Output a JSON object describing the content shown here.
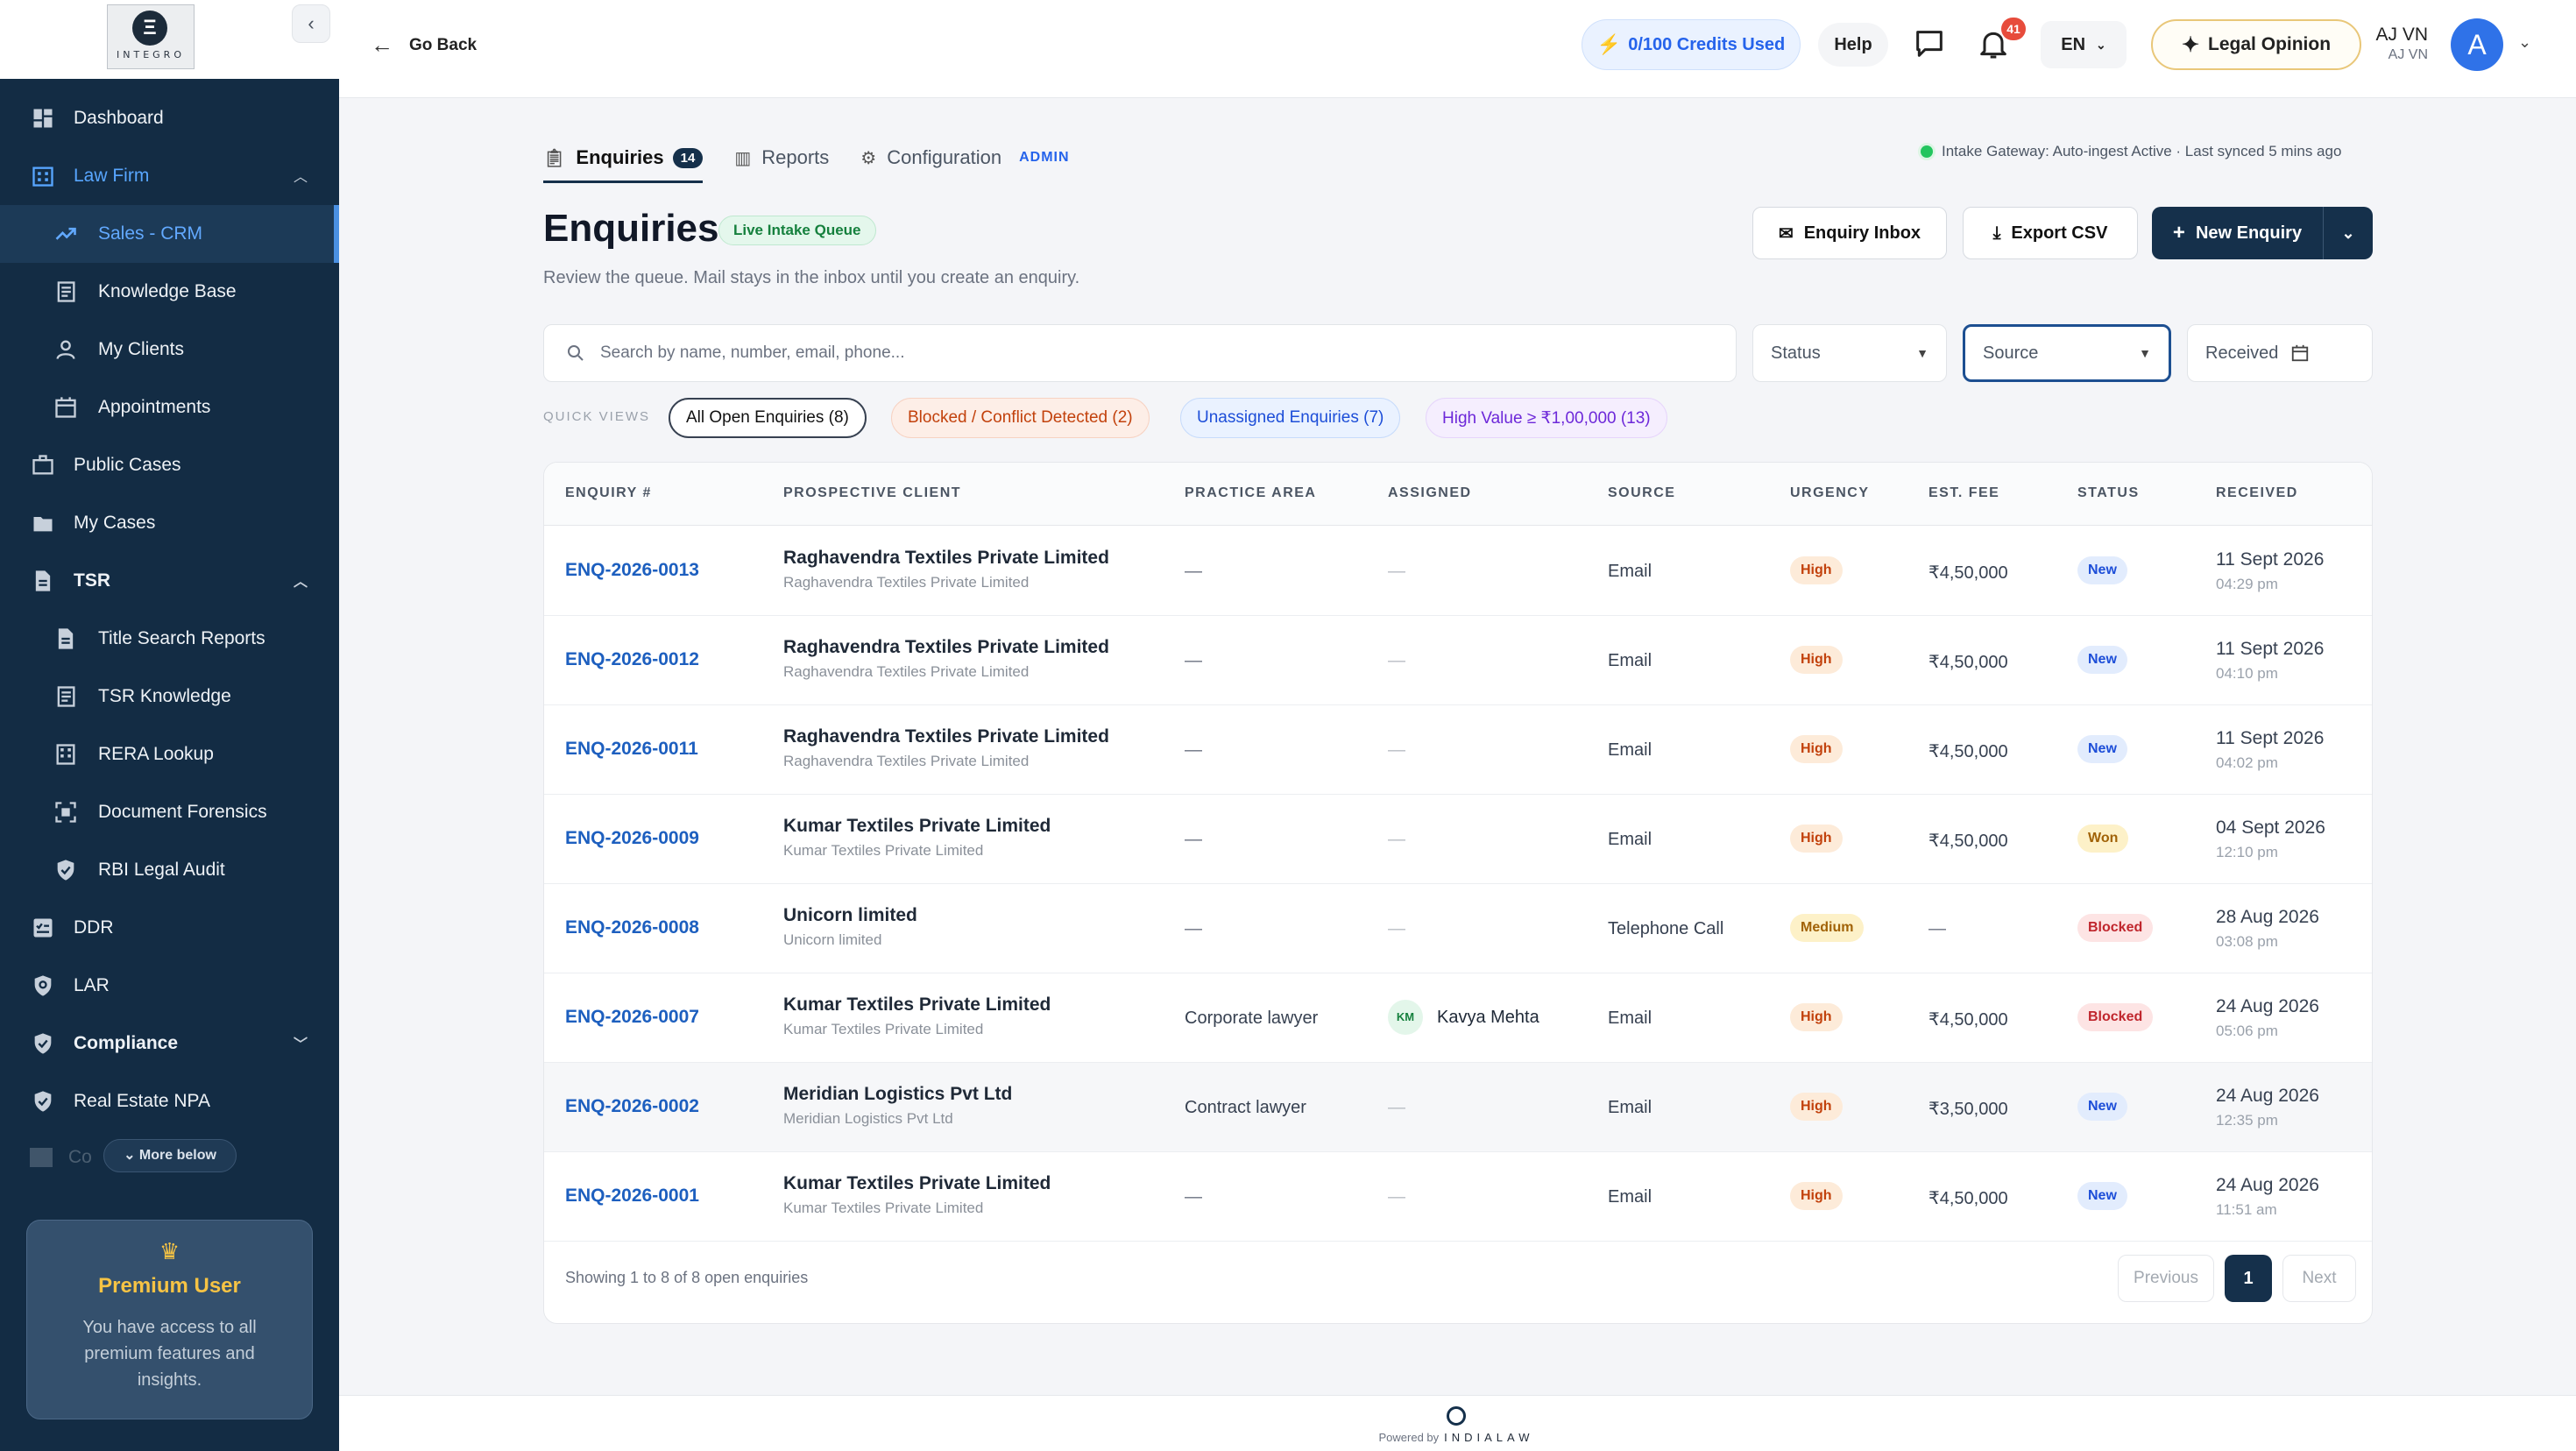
{
  "brand": {
    "logo_letter": "Ξ",
    "logo_text": "INTEGRO"
  },
  "sidebar": {
    "items": [
      {
        "label": "Dashboard"
      },
      {
        "label": "Law Firm"
      },
      {
        "label": "Sales - CRM"
      },
      {
        "label": "Knowledge Base"
      },
      {
        "label": "My Clients"
      },
      {
        "label": "Appointments"
      },
      {
        "label": "Public Cases"
      },
      {
        "label": "My Cases"
      },
      {
        "label": "TSR"
      },
      {
        "label": "Title Search Reports"
      },
      {
        "label": "TSR Knowledge"
      },
      {
        "label": "RERA Lookup"
      },
      {
        "label": "Document Forensics"
      },
      {
        "label": "RBI Legal Audit"
      },
      {
        "label": "DDR"
      },
      {
        "label": "LAR"
      },
      {
        "label": "Compliance"
      },
      {
        "label": "Real Estate NPA"
      }
    ],
    "faded_item": "Co",
    "more_below": "More below",
    "premium": {
      "title": "Premium User",
      "desc": "You have access to all premium features and insights."
    }
  },
  "topbar": {
    "go_back": "Go Back",
    "credits": "0/100 Credits Used",
    "help": "Help",
    "notif_count": "41",
    "lang": "EN",
    "legal_opinion": "Legal Opinion",
    "user_name": "AJ VN",
    "user_sub": "AJ VN",
    "avatar_letter": "A"
  },
  "tabs": {
    "enquiries": "Enquiries",
    "enquiries_count": "14",
    "reports": "Reports",
    "configuration": "Configuration",
    "admin": "ADMIN"
  },
  "sync_status": "Intake Gateway: Auto-ingest Active · Last synced 5 mins ago",
  "page": {
    "title": "Enquiries",
    "live_badge": "Live Intake Queue",
    "subtitle": "Review the queue. Mail stays in the inbox until you create an enquiry."
  },
  "actions": {
    "inbox": "Enquiry Inbox",
    "export": "Export CSV",
    "new": "New Enquiry"
  },
  "filters": {
    "search_placeholder": "Search by name, number, email, phone...",
    "status": "Status",
    "source": "Source",
    "received": "Received"
  },
  "quick_views": {
    "label": "QUICK VIEWS",
    "chips": [
      "All Open Enquiries  (8)",
      "Blocked / Conflict Detected  (2)",
      "Unassigned Enquiries  (7)",
      "High Value ≥ ₹1,00,000  (13)"
    ]
  },
  "table": {
    "headers": [
      "ENQUIRY #",
      "PROSPECTIVE CLIENT",
      "PRACTICE AREA",
      "ASSIGNED",
      "SOURCE",
      "URGENCY",
      "EST. FEE",
      "STATUS",
      "RECEIVED"
    ],
    "rows": [
      {
        "id": "ENQ-2026-0013",
        "client": "Raghavendra Textiles Private Limited",
        "client_sub": "Raghavendra Textiles Private Limited",
        "practice": "—",
        "assigned": "—",
        "source": "Email",
        "urgency": "High",
        "fee": "₹4,50,000",
        "status": "New",
        "date": "11 Sept 2026",
        "time": "04:29 pm"
      },
      {
        "id": "ENQ-2026-0012",
        "client": "Raghavendra Textiles Private Limited",
        "client_sub": "Raghavendra Textiles Private Limited",
        "practice": "—",
        "assigned": "—",
        "source": "Email",
        "urgency": "High",
        "fee": "₹4,50,000",
        "status": "New",
        "date": "11 Sept 2026",
        "time": "04:10 pm"
      },
      {
        "id": "ENQ-2026-0011",
        "client": "Raghavendra Textiles Private Limited",
        "client_sub": "Raghavendra Textiles Private Limited",
        "practice": "—",
        "assigned": "—",
        "source": "Email",
        "urgency": "High",
        "fee": "₹4,50,000",
        "status": "New",
        "date": "11 Sept 2026",
        "time": "04:02 pm"
      },
      {
        "id": "ENQ-2026-0009",
        "client": "Kumar Textiles Private Limited",
        "client_sub": "Kumar Textiles Private Limited",
        "practice": "—",
        "assigned": "—",
        "source": "Email",
        "urgency": "High",
        "fee": "₹4,50,000",
        "status": "Won",
        "date": "04 Sept 2026",
        "time": "12:10 pm"
      },
      {
        "id": "ENQ-2026-0008",
        "client": "Unicorn limited",
        "client_sub": "Unicorn limited",
        "practice": "—",
        "assigned": "—",
        "source": "Telephone Call",
        "urgency": "Medium",
        "fee": "—",
        "status": "Blocked",
        "date": "28 Aug 2026",
        "time": "03:08 pm"
      },
      {
        "id": "ENQ-2026-0007",
        "client": "Kumar Textiles Private Limited",
        "client_sub": "Kumar Textiles Private Limited",
        "practice": "Corporate lawyer",
        "assigned_initials": "KM",
        "assigned": "Kavya Mehta",
        "source": "Email",
        "urgency": "High",
        "fee": "₹4,50,000",
        "status": "Blocked",
        "date": "24 Aug 2026",
        "time": "05:06 pm"
      },
      {
        "id": "ENQ-2026-0002",
        "client": "Meridian Logistics Pvt Ltd",
        "client_sub": "Meridian Logistics Pvt Ltd",
        "practice": "Contract lawyer",
        "assigned": "—",
        "source": "Email",
        "urgency": "High",
        "fee": "₹3,50,000",
        "status": "New",
        "date": "24 Aug 2026",
        "time": "12:35 pm"
      },
      {
        "id": "ENQ-2026-0001",
        "client": "Kumar Textiles Private Limited",
        "client_sub": "Kumar Textiles Private Limited",
        "practice": "—",
        "assigned": "—",
        "source": "Email",
        "urgency": "High",
        "fee": "₹4,50,000",
        "status": "New",
        "date": "24 Aug 2026",
        "time": "11:51 am"
      }
    ],
    "footer": "Showing 1 to 8 of 8 open enquiries",
    "pagination": {
      "previous": "Previous",
      "current": "1",
      "next": "Next"
    }
  },
  "footer": {
    "powered_by": "Powered by",
    "brand": "INDIALAW"
  },
  "colors": {
    "sidebar": "#132c44",
    "primary": "#15304b",
    "accent": "#2563eb",
    "link": "#1d5fbf"
  },
  "icons": [
    "dashboard-icon",
    "building-icon",
    "trend-icon",
    "book-icon",
    "user-icon",
    "calendar-icon",
    "briefcase-icon",
    "folder-icon",
    "file-icon",
    "shield-icon",
    "crown-icon",
    "search-icon",
    "bell-icon",
    "chat-icon",
    "sparkle-icon",
    "bolt-icon"
  ]
}
